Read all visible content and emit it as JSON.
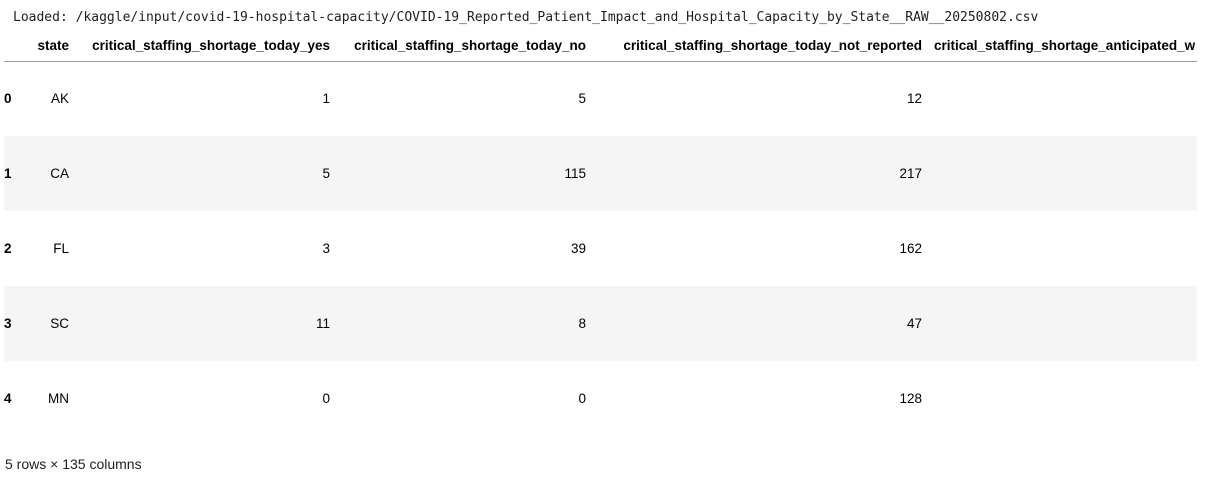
{
  "stdout": {
    "loaded_message": "Loaded: /kaggle/input/covid-19-hospital-capacity/COVID-19_Reported_Patient_Impact_and_Hospital_Capacity_by_State__RAW__20250802.csv"
  },
  "table": {
    "index_header": "",
    "columns": [
      "state",
      "critical_staffing_shortage_today_yes",
      "critical_staffing_shortage_today_no",
      "critical_staffing_shortage_today_not_reported",
      "critical_staffing_shortage_anticipated_w"
    ],
    "rows": [
      {
        "index": "0",
        "cells": [
          "AK",
          "1",
          "5",
          "12",
          ""
        ]
      },
      {
        "index": "1",
        "cells": [
          "CA",
          "5",
          "115",
          "217",
          ""
        ]
      },
      {
        "index": "2",
        "cells": [
          "FL",
          "3",
          "39",
          "162",
          ""
        ]
      },
      {
        "index": "3",
        "cells": [
          "SC",
          "11",
          "8",
          "47",
          ""
        ]
      },
      {
        "index": "4",
        "cells": [
          "MN",
          "0",
          "0",
          "128",
          ""
        ]
      }
    ]
  },
  "footer": {
    "shape_text": "5 rows × 135 columns"
  }
}
